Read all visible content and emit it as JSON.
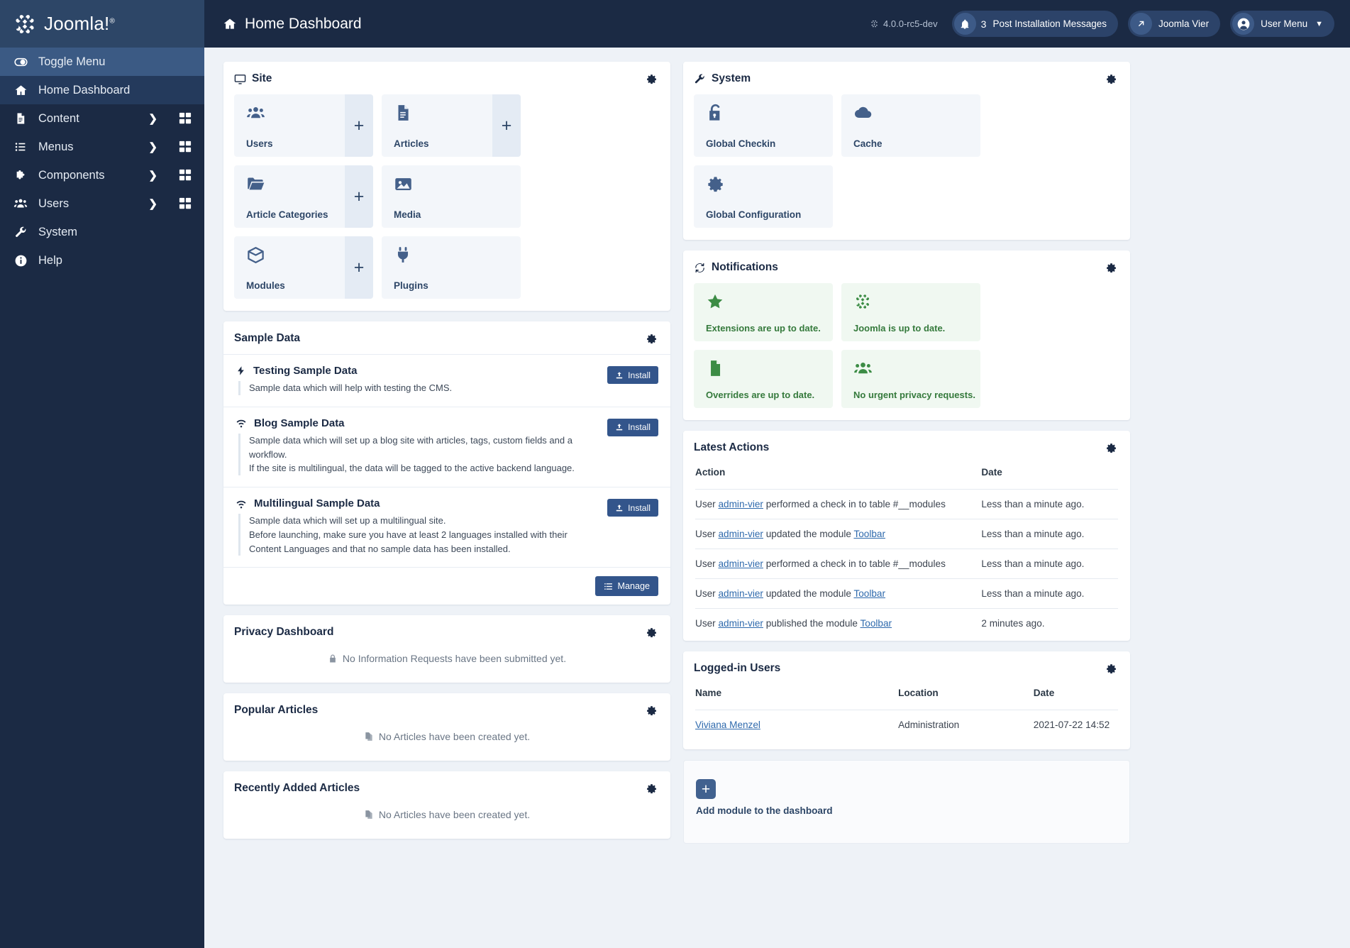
{
  "brand": {
    "name": "Joomla!",
    "trademark": "®",
    "logo_icon": "joomla-logo-icon"
  },
  "header": {
    "page_title": "Home Dashboard",
    "home_icon": "home-icon",
    "version": "4.0.0-rc5-dev",
    "version_icon": "joomla-mark-icon",
    "notifications": {
      "count": "3",
      "label": "Post Installation Messages",
      "icon": "bell-icon"
    },
    "site_link": {
      "label": "Joomla Vier",
      "icon": "external-link-icon"
    },
    "user_menu": {
      "label": "User Menu",
      "icon": "user-circle-icon",
      "chevron": "chevron-down-icon"
    }
  },
  "sidebar": {
    "items": [
      {
        "label": "Toggle Menu",
        "icon": "toggle-icon",
        "state": "toggle",
        "arrow": false,
        "grid": false
      },
      {
        "label": "Home Dashboard",
        "icon": "home-icon",
        "state": "active",
        "arrow": false,
        "grid": false
      },
      {
        "label": "Content",
        "icon": "document-icon",
        "state": "",
        "arrow": true,
        "grid": true
      },
      {
        "label": "Menus",
        "icon": "list-icon",
        "state": "",
        "arrow": true,
        "grid": true
      },
      {
        "label": "Components",
        "icon": "puzzle-icon",
        "state": "",
        "arrow": true,
        "grid": true
      },
      {
        "label": "Users",
        "icon": "users-icon",
        "state": "",
        "arrow": true,
        "grid": true
      },
      {
        "label": "System",
        "icon": "wrench-icon",
        "state": "",
        "arrow": false,
        "grid": false
      },
      {
        "label": "Help",
        "icon": "info-icon",
        "state": "",
        "arrow": false,
        "grid": false
      }
    ]
  },
  "site_panel": {
    "title": "Site",
    "title_icon": "monitor-icon",
    "gear_icon": "gear-icon",
    "tiles": [
      {
        "label": "Users",
        "icon": "users-icon",
        "plus": true
      },
      {
        "label": "Articles",
        "icon": "article-icon",
        "plus": true
      },
      {
        "label": "Article Categories",
        "icon": "folder-icon",
        "plus": true
      },
      {
        "label": "Media",
        "icon": "image-icon",
        "plus": false
      },
      {
        "label": "Modules",
        "icon": "cube-icon",
        "plus": true
      },
      {
        "label": "Plugins",
        "icon": "plug-icon",
        "plus": false
      }
    ]
  },
  "system_panel": {
    "title": "System",
    "title_icon": "wrench-icon",
    "gear_icon": "gear-icon",
    "tiles": [
      {
        "label": "Global Checkin",
        "icon": "unlock-icon"
      },
      {
        "label": "Cache",
        "icon": "cloud-icon"
      },
      {
        "label": "Global Configuration",
        "icon": "gear-icon"
      }
    ]
  },
  "notifications_panel": {
    "title": "Notifications",
    "title_icon": "sync-icon",
    "gear_icon": "gear-icon",
    "accent": "#3c8c45",
    "tiles": [
      {
        "label": "Extensions are up to date.",
        "icon": "star-icon"
      },
      {
        "label": "Joomla is up to date.",
        "icon": "joomla-mark-icon"
      },
      {
        "label": "Overrides are up to date.",
        "icon": "file-icon"
      },
      {
        "label": "No urgent privacy requests.",
        "icon": "users-icon"
      }
    ]
  },
  "sample_data": {
    "title": "Sample Data",
    "gear_icon": "gear-icon",
    "install_label": "Install",
    "install_icon": "upload-icon",
    "manage_label": "Manage",
    "manage_icon": "list-settings-icon",
    "rows": [
      {
        "title": "Testing Sample Data",
        "icon": "bolt-icon",
        "lines": [
          "Sample data which will help with testing the CMS."
        ]
      },
      {
        "title": "Blog Sample Data",
        "icon": "wifi-icon",
        "lines": [
          "Sample data which will set up a blog site with articles, tags, custom fields and a workflow.",
          "If the site is multilingual, the data will be tagged to the active backend language."
        ]
      },
      {
        "title": "Multilingual Sample Data",
        "icon": "wifi-icon",
        "lines": [
          "Sample data which will set up a multilingual site.",
          "Before launching, make sure you have at least 2 languages installed with their Content Languages and that no sample data has been installed."
        ]
      }
    ]
  },
  "privacy_panel": {
    "title": "Privacy Dashboard",
    "gear_icon": "gear-icon",
    "empty_icon": "lock-icon",
    "empty_text": "No Information Requests have been submitted yet."
  },
  "popular_articles": {
    "title": "Popular Articles",
    "gear_icon": "gear-icon",
    "empty_icon": "copy-icon",
    "empty_text": "No Articles have been created yet."
  },
  "recent_articles": {
    "title": "Recently Added Articles",
    "gear_icon": "gear-icon",
    "empty_icon": "copy-icon",
    "empty_text": "No Articles have been created yet."
  },
  "latest_actions": {
    "title": "Latest Actions",
    "gear_icon": "gear-icon",
    "columns": [
      "Action",
      "Date"
    ],
    "rows": [
      {
        "prefix": "User ",
        "user": "admin-vier",
        "middle": " performed a check in to table #__modules",
        "link2": "",
        "suffix": "",
        "date": "Less than a minute ago."
      },
      {
        "prefix": "User ",
        "user": "admin-vier",
        "middle": " updated the module ",
        "link2": "Toolbar",
        "suffix": "",
        "date": "Less than a minute ago."
      },
      {
        "prefix": "User ",
        "user": "admin-vier",
        "middle": " performed a check in to table #__modules",
        "link2": "",
        "suffix": "",
        "date": "Less than a minute ago."
      },
      {
        "prefix": "User ",
        "user": "admin-vier",
        "middle": " updated the module ",
        "link2": "Toolbar",
        "suffix": "",
        "date": "Less than a minute ago."
      },
      {
        "prefix": "User ",
        "user": "admin-vier",
        "middle": " published the module ",
        "link2": "Toolbar",
        "suffix": "",
        "date": "2 minutes ago."
      }
    ]
  },
  "logged_in_users": {
    "title": "Logged-in Users",
    "gear_icon": "gear-icon",
    "columns": [
      "Name",
      "Location",
      "Date"
    ],
    "rows": [
      {
        "name": "Viviana Menzel",
        "location": "Administration",
        "date": "2021-07-22 14:52"
      }
    ]
  },
  "add_module": {
    "label": "Add module to the dashboard",
    "icon": "plus-square-icon"
  }
}
